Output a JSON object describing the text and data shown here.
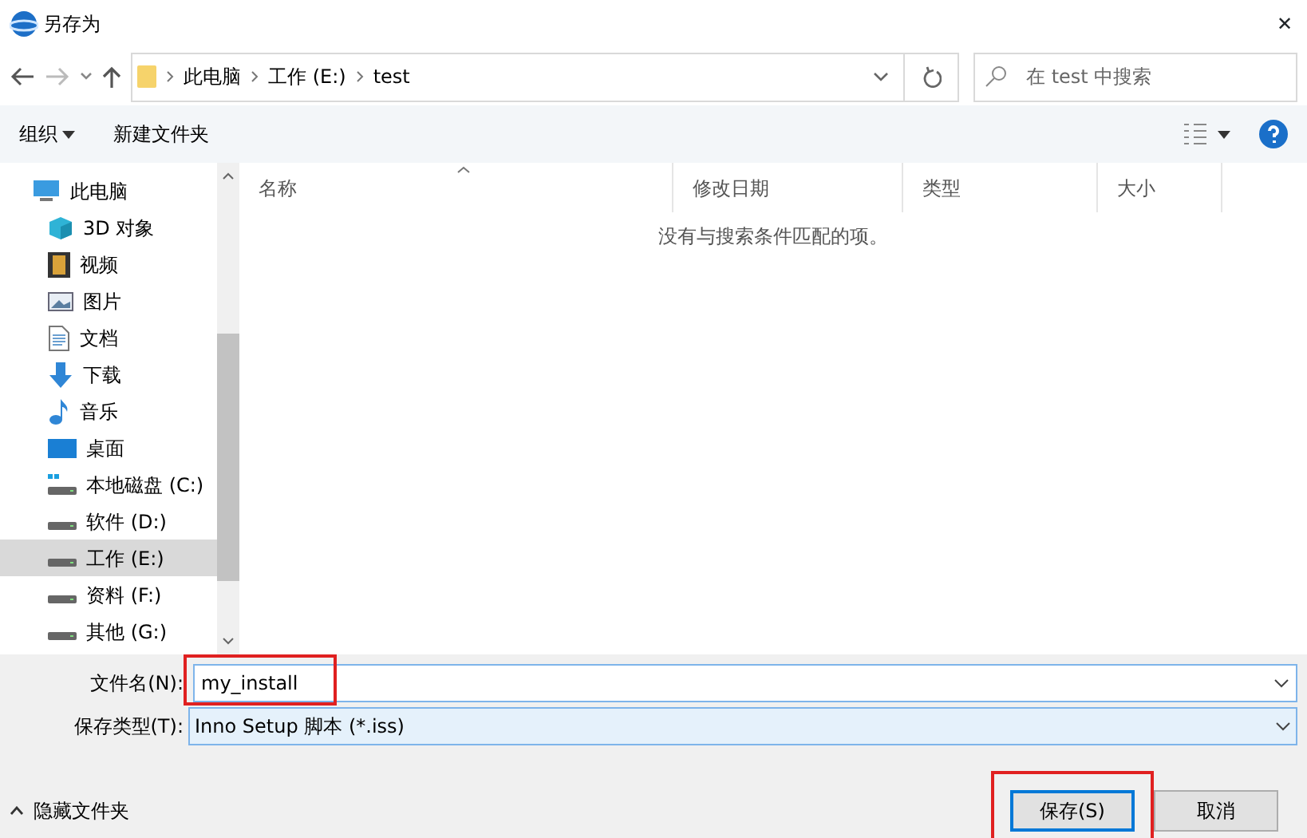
{
  "window": {
    "title": "另存为",
    "close": "✕"
  },
  "address": {
    "path": [
      {
        "label": "此电脑"
      },
      {
        "label": "工作 (E:)"
      },
      {
        "label": "test"
      }
    ]
  },
  "search": {
    "placeholder": "在 test 中搜索"
  },
  "toolbar": {
    "organize": "组织",
    "new_folder": "新建文件夹"
  },
  "sidebar": {
    "items": [
      {
        "label": "此电脑",
        "kind": "pc",
        "selected": false,
        "children": [
          {
            "label": "3D 对象",
            "kind": "cube",
            "selected": false
          },
          {
            "label": "视频",
            "kind": "video",
            "selected": false
          },
          {
            "label": "图片",
            "kind": "picture",
            "selected": false
          },
          {
            "label": "文档",
            "kind": "doc",
            "selected": false
          },
          {
            "label": "下载",
            "kind": "download",
            "selected": false
          },
          {
            "label": "音乐",
            "kind": "music",
            "selected": false
          },
          {
            "label": "桌面",
            "kind": "desktop",
            "selected": false
          },
          {
            "label": "本地磁盘 (C:)",
            "kind": "sysdrive",
            "selected": false
          },
          {
            "label": "软件 (D:)",
            "kind": "drive",
            "selected": false
          },
          {
            "label": "工作 (E:)",
            "kind": "drive",
            "selected": true
          },
          {
            "label": "资料 (F:)",
            "kind": "drive",
            "selected": false
          },
          {
            "label": "其他 (G:)",
            "kind": "drive",
            "selected": false
          }
        ]
      }
    ]
  },
  "table": {
    "columns": [
      {
        "label": "名称",
        "sorted": true
      },
      {
        "label": "修改日期",
        "sorted": false
      },
      {
        "label": "类型",
        "sorted": false
      },
      {
        "label": "大小",
        "sorted": false
      }
    ],
    "empty_message": "没有与搜索条件匹配的项。"
  },
  "form": {
    "filename": {
      "label": "文件名(N):",
      "value": "my_install",
      "highlighted": true
    },
    "filetype": {
      "label": "保存类型(T):",
      "value": "Inno Setup 脚本 (*.iss)"
    }
  },
  "footer": {
    "hide_folders": "隐藏文件夹",
    "save_button": {
      "label": "保存(S)",
      "highlighted": true
    },
    "cancel_button": "取消"
  }
}
